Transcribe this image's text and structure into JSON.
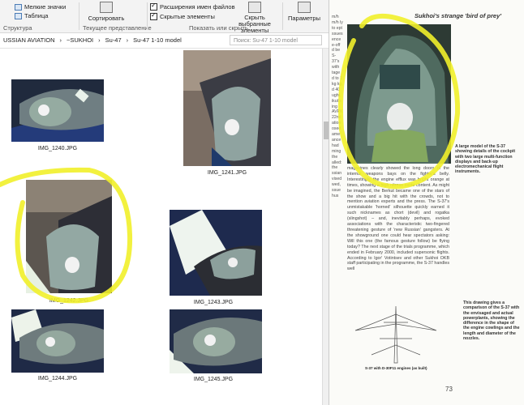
{
  "ribbon": {
    "view_items": [
      "Мелкие значки",
      "Таблица"
    ],
    "structure_label": "Структура",
    "sort_label": "Сортировать",
    "current_view_label": "Текущее представление",
    "checkboxes": [
      "Расширения имен файлов",
      "Скрытые элементы"
    ],
    "hide_selected_label": "Скрыть выбранные элементы",
    "show_hide_label": "Показать или скрыть",
    "options_label": "Параметры"
  },
  "address": {
    "crumbs": [
      "USSIAN AVIATION",
      "›",
      "~SUKHOI",
      "›",
      "Su-47",
      "›",
      "Su-47 1-10 model"
    ],
    "search_placeholder": "Поиск: Su-47 1-10 model"
  },
  "files": [
    {
      "name": "IMG_1240.JPG"
    },
    {
      "name": "IMG_1241.JPG"
    },
    {
      "name": "IMG_1242.JPG"
    },
    {
      "name": "IMG_1243.JPG"
    },
    {
      "name": "IMG_1244.JPG"
    },
    {
      "name": "IMG_1245.JPG"
    }
  ],
  "book": {
    "header": "Sukhoi's strange 'bird of prey'",
    "caption_top": "A large model of the S-37 showing details of the cockpit with two large multi-function displays and back-up electromechanical flight instruments.",
    "caption_bottom": "This drawing gives a comparison of the S-37 with the envisaged and actual powerplants, showing the difference in the shape of the engine cowlings and the length and diameter of the nozzles.",
    "drawing_label": "S-37 with D-30F11 engines (as built)",
    "body": "magazines clearly showed the long doors of the internal weapons bays on the fighter's belly. Interestingly, the engine efflux was bright orange at times, showing a high nitrous oxide content. As might be imagined, the Berkut became one of the stars of the show and a big hit with the crowds, not to mention aviation experts and the press. The S-37's unmistakable 'horned' silhouette quickly earned it such nicknames as chort (devil) and rogatka (slingshot) – and, inevitably perhaps, evoked associations with the characteristic two-fingered threatening gesture of 'new Russian' gangsters. At the showground one could hear spectators asking: Will this one (the famous gesture follow) be flying today? The next stage of the trials programme, which ended in February 2000, included supersonic flights. According to Igor' Votintsev and other Sukhoi OKB staff participating in the programme, the S-37 handles well",
    "margin_text": "m/h m/h ly to ept ssues ence e-off d be S-37's with tage d to 1 kg kg, d 40 ught, ikut's ing AVPK 22nd ation osed ame ance had ming the alled: the ssian vised wed, ssue hus",
    "page_number": "73"
  },
  "colors": {
    "highlight": "#f1ef2a",
    "accent": "#4a7bb5"
  }
}
